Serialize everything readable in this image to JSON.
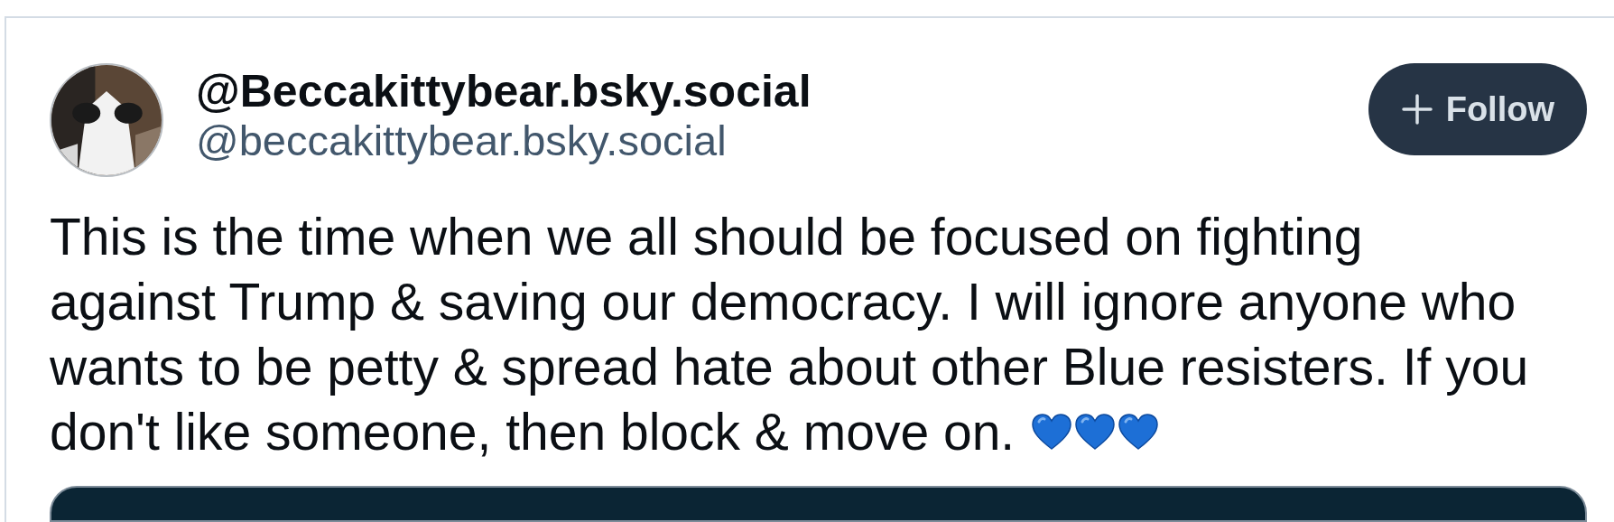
{
  "post": {
    "display_name": "@Beccakittybear.bsky.social",
    "handle": "@beccakittybear.bsky.social",
    "follow_button": {
      "label": "Follow"
    },
    "text_lines": [
      "This is the time when we all should be focused on fighting",
      "against Trump & saving our democracy. I will ignore anyone who",
      "wants to be petty & spread hate about other Blue resisters. If you",
      "don't like someone, then block & move on."
    ],
    "embed": {
      "kind": "card"
    }
  }
}
